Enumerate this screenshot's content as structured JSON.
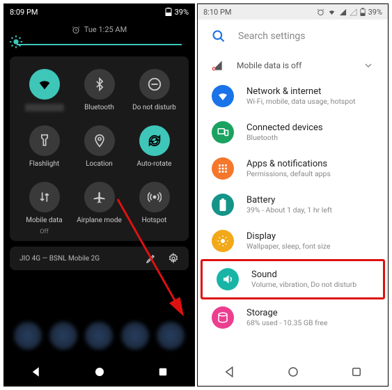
{
  "left": {
    "status": {
      "time": "8:09 PM",
      "battery": "39%"
    },
    "alarm": "Tue 1:25 AM",
    "tiles": [
      {
        "name": "wifi",
        "label": "",
        "active": true
      },
      {
        "name": "bluetooth",
        "label": "Bluetooth",
        "active": false
      },
      {
        "name": "dnd",
        "label": "Do not disturb",
        "active": false
      },
      {
        "name": "flashlight",
        "label": "Flashlight",
        "active": false
      },
      {
        "name": "location",
        "label": "Location",
        "active": false
      },
      {
        "name": "autorotate",
        "label": "Auto-rotate",
        "active": true
      },
      {
        "name": "mobiledata",
        "label": "Mobile data",
        "sub": "Off",
        "active": false
      },
      {
        "name": "airplane",
        "label": "Airplane mode",
        "active": false
      },
      {
        "name": "hotspot",
        "label": "Hotspot",
        "active": false
      }
    ],
    "footer": "JIO 4G — BSNL Mobile 2G"
  },
  "right": {
    "status": {
      "time": "8:10 PM",
      "battery": "39%"
    },
    "search_placeholder": "Search settings",
    "mobile_data": "Mobile data is off",
    "items": [
      {
        "title": "Network & internet",
        "sub": "Wi-Fi, mobile, data usage, hotspot",
        "color": "#1a73e8"
      },
      {
        "title": "Connected devices",
        "sub": "Bluetooth",
        "color": "#1ba260"
      },
      {
        "title": "Apps & notifications",
        "sub": "Permissions, default apps",
        "color": "#f5772c"
      },
      {
        "title": "Battery",
        "sub": "39% - About 1 day, 1 hr left",
        "color": "#159488"
      },
      {
        "title": "Display",
        "sub": "Wallpaper, sleep, font size",
        "color": "#f2a818"
      },
      {
        "title": "Sound",
        "sub": "Volume, vibration, Do not disturb",
        "color": "#18b5a7"
      },
      {
        "title": "Storage",
        "sub": "68% used - 10.35 GB free",
        "color": "#ec3e8f"
      }
    ]
  },
  "colors": {
    "accent": "#3ec6b9"
  }
}
